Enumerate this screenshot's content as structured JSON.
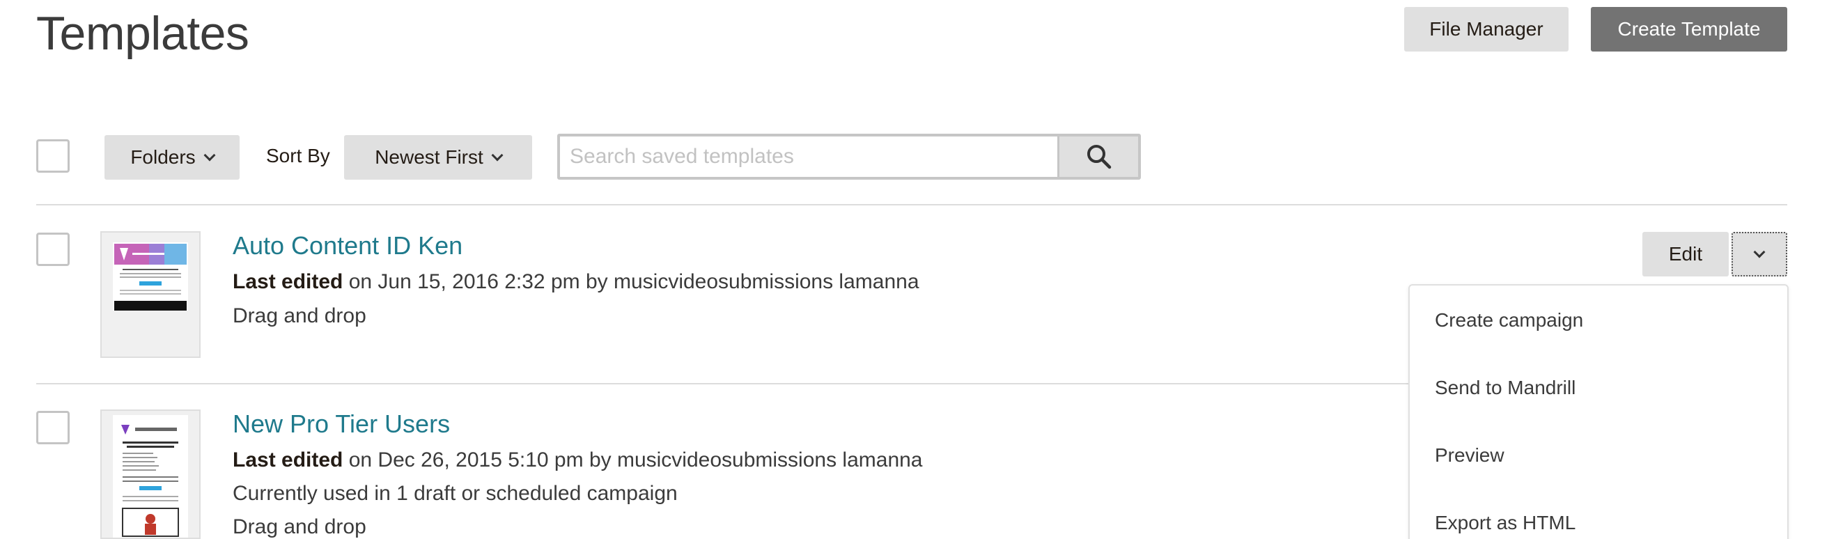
{
  "header": {
    "title": "Templates",
    "file_manager_label": "File Manager",
    "create_template_label": "Create Template"
  },
  "toolbar": {
    "folders_label": "Folders",
    "sort_by_label": "Sort By",
    "sort_value": "Newest First",
    "search_placeholder": "Search saved templates",
    "search_value": ""
  },
  "templates": [
    {
      "title": "Auto Content ID Ken",
      "last_edited_label": "Last edited",
      "edited_info": " on Jun 15, 2016 2:32 pm by musicvideosubmissions lamanna",
      "type": "Drag and drop"
    },
    {
      "title": "New Pro Tier Users",
      "last_edited_label": "Last edited",
      "edited_info": " on Dec 26, 2015 5:10 pm by musicvideosubmissions lamanna",
      "usage": "Currently used in 1 draft or scheduled campaign",
      "type": "Drag and drop"
    }
  ],
  "row_actions": {
    "edit_label": "Edit"
  },
  "dropdown_menu": {
    "items": [
      "Create campaign",
      "Send to Mandrill",
      "Preview",
      "Export as HTML"
    ]
  },
  "colors": {
    "link": "#1f7a8c",
    "primary_button": "#737373",
    "secondary_button": "#e0e0e0"
  }
}
